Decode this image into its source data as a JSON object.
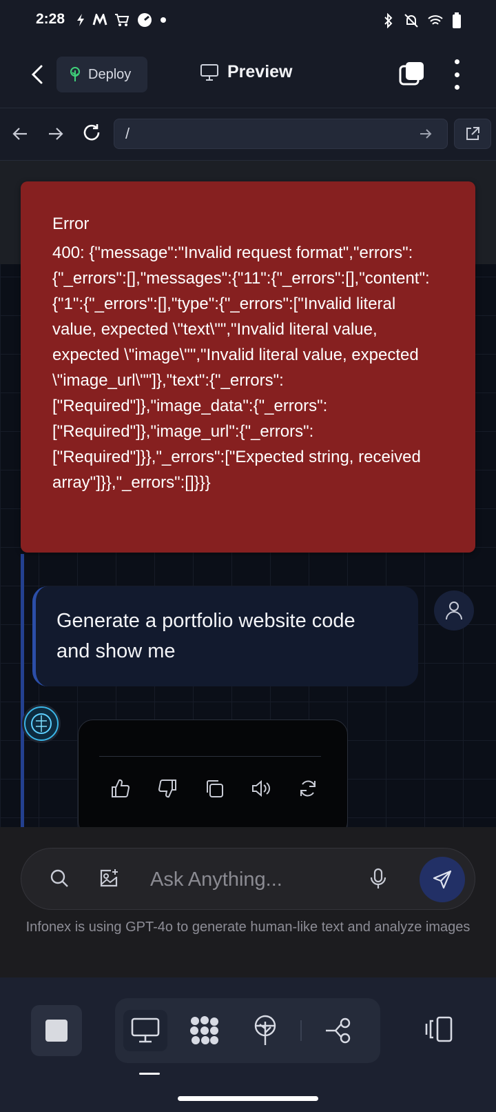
{
  "status_bar": {
    "time": "2:28"
  },
  "header": {
    "deploy_label": "Deploy",
    "title": "Preview"
  },
  "url_bar": {
    "url": "/"
  },
  "error": {
    "title": "Error",
    "message": "400: {\"message\":\"Invalid request format\",\"errors\":{\"_errors\":[],\"messages\":{\"11\":{\"_errors\":[],\"content\":{\"1\":{\"_errors\":[],\"type\":{\"_errors\":[\"Invalid literal value, expected \\\"text\\\"\",\"Invalid literal value, expected \\\"image\\\"\",\"Invalid literal value, expected \\\"image_url\\\"\"]},\"text\":{\"_errors\":[\"Required\"]},\"image_data\":{\"_errors\":[\"Required\"]},\"image_url\":{\"_errors\":[\"Required\"]}},\"_errors\":[\"Expected string, received array\"]}},\"_errors\":[]}}}"
  },
  "messages": {
    "user_text": "Generate a portfolio website code and show me"
  },
  "input": {
    "placeholder": "Ask Anything...",
    "value": "",
    "footer_note": "Infonex is using GPT-4o to generate human-like text and analyze images"
  },
  "icons": {
    "back": "chevron-left-icon",
    "deploy": "tree-icon",
    "preview": "monitor-icon",
    "tabs": "tabs-icon",
    "more": "more-vertical-icon",
    "nav_back": "arrow-left-icon",
    "nav_forward": "arrow-right-icon",
    "reload": "reload-icon",
    "go": "arrow-right-icon",
    "external": "external-link-icon",
    "user_avatar": "user-icon",
    "bot_avatar": "brain-icon",
    "like": "thumbs-up-icon",
    "dislike": "thumbs-down-icon",
    "copy": "copy-icon",
    "speak": "speaker-icon",
    "regenerate": "refresh-icon",
    "search": "search-icon",
    "image_add": "image-plus-icon",
    "mic": "mic-icon",
    "send": "send-icon",
    "stop": "stop-icon",
    "desktop": "monitor-icon",
    "dots": "dots-icon",
    "tree": "tree-icon",
    "share": "share-icon",
    "layout": "layout-icon"
  },
  "colors": {
    "error_bg": "#862020",
    "accent": "#2b4ea8",
    "send_bg": "#223066",
    "deploy_icon": "#3fd17a"
  }
}
